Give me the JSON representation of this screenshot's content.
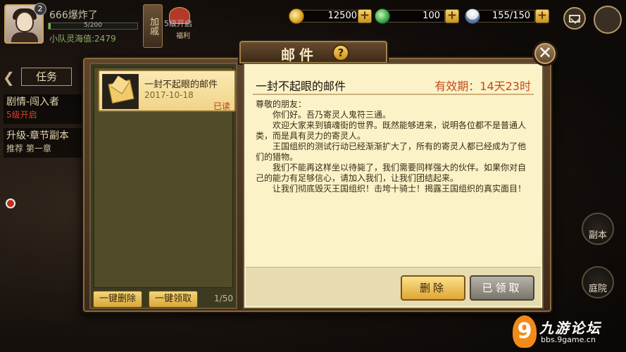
{
  "player": {
    "level": "2",
    "name": "666爆炸了",
    "exp": "5/200",
    "exp_ratio": 0.025,
    "team_power": "小队灵海值:2479"
  },
  "hud": {
    "stamp_label": "加戚",
    "welfare_lock": "5级开启",
    "welfare_label": "福利"
  },
  "resources": [
    {
      "name": "coin",
      "icon": "coin-icon",
      "value": "12500"
    },
    {
      "name": "jade",
      "icon": "jade-icon",
      "value": "100"
    },
    {
      "name": "rice",
      "icon": "rice-bowl-icon",
      "value": "155/150"
    }
  ],
  "quests": {
    "tab_label": "任务",
    "items": [
      {
        "title": "剧情-闯入者",
        "subtitle": "5级开启"
      },
      {
        "title": "升级-章节副本",
        "subtitle": "推荐  第一章"
      }
    ]
  },
  "side_buttons": [
    {
      "label": "副本"
    },
    {
      "label": "庭院"
    }
  ],
  "mail": {
    "title": "邮件",
    "help": "?",
    "close": "✕",
    "list": [
      {
        "subject": "一封不起眼的邮件",
        "date": "2017-10-18",
        "status": "已读"
      }
    ],
    "delete_all": "一键删除",
    "claim_all": "一键领取",
    "count": "1/50",
    "detail": {
      "subject": "一封不起眼的邮件",
      "validity": "有效期：14天23时",
      "greeting": "尊敬的朋友：",
      "paragraphs": [
        "你们好。吾乃寄灵人鬼符三通。",
        "欢迎大家来到镇魂街的世界。既然能够进来，说明各位都不是普通人类，而是具有灵力的寄灵人。",
        "王国组织的测试行动已经渐渐扩大了，所有的寄灵人都已经成为了他们的猎物。",
        "我们不能再这样坐以待毙了，我们需要同样强大的伙伴。如果你对自己的能力有足够信心，请加入我们，让我们团结起来。",
        "让我们彻底毁灭王国组织！击垮十骑士！揭露王国组织的真实面目！"
      ],
      "delete_label": "删除",
      "claimed_label": "已领取"
    }
  },
  "watermark": {
    "logo": "9",
    "name": "九游论坛",
    "url": "bbs.9game.cn"
  },
  "colors": {
    "accent": "#f0d487",
    "validity": "#c44a1a",
    "read_status": "#b5351c"
  }
}
